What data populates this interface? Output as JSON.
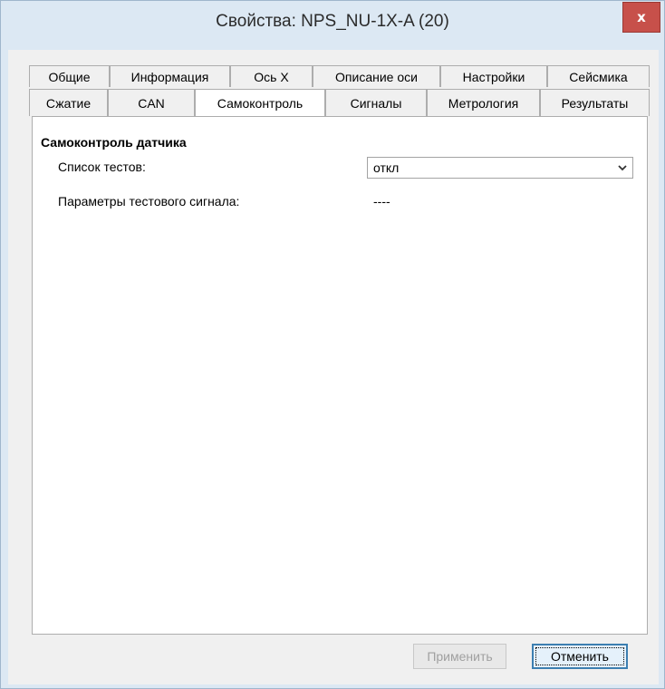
{
  "window": {
    "title": "Свойства: NPS_NU-1X-A (20)",
    "close_glyph": "x"
  },
  "tabs": {
    "row1": [
      "Общие",
      "Информация",
      "Ось X",
      "Описание оси",
      "Настройки",
      "Сейсмика"
    ],
    "row2": [
      "Сжатие",
      "CAN",
      "Самоконтроль",
      "Сигналы",
      "Метрология",
      "Результаты"
    ],
    "active": "Самоконтроль"
  },
  "panel": {
    "group_title": "Самоконтроль датчика",
    "tests_label": "Список тестов:",
    "tests_value": "откл",
    "signal_params_label": "Параметры тестового сигнала:",
    "signal_params_value": "----"
  },
  "buttons": {
    "apply": "Применить",
    "cancel": "Отменить"
  },
  "icons": {
    "close": "close-icon",
    "dropdown": "chevron-down-icon"
  }
}
